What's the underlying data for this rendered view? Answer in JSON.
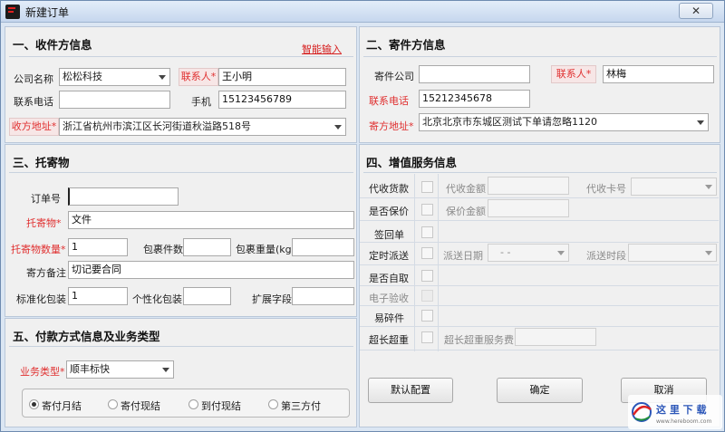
{
  "window": {
    "title": "新建订单",
    "close_label": "✕"
  },
  "recipient": {
    "section_title": "一、收件方信息",
    "smart_input_link": "智能输入",
    "company_label": "公司名称",
    "company_value": "松松科技",
    "contact_label": "联系人*",
    "contact_value": "王小明",
    "phone_label": "联系电话",
    "phone_value": "",
    "mobile_label": "手机",
    "mobile_value": "15123456789",
    "address_label": "收方地址*",
    "address_value": "浙江省杭州市滨江区长河街道秋溢路518号"
  },
  "sender": {
    "section_title": "二、寄件方信息",
    "company_label": "寄件公司",
    "company_value": "",
    "contact_label": "联系人*",
    "contact_value": "林梅",
    "phone_label": "联系电话",
    "phone_value": "15212345678",
    "address_label": "寄方地址*",
    "address_value": "北京北京市东城区测试下单请忽略1120"
  },
  "consignment": {
    "section_title": "三、托寄物",
    "order_no_label": "订单号",
    "order_no_value": "",
    "item_label": "托寄物*",
    "item_value": "文件",
    "qty_label": "托寄物数量*",
    "qty_value": "1",
    "pkg_count_label": "包裹件数",
    "pkg_count_value": "",
    "pkg_weight_label": "包裹重量(kg)",
    "pkg_weight_value": "",
    "remark_label": "寄方备注",
    "remark_value": "切记要合同",
    "std_pkg_label": "标准化包装",
    "std_pkg_value": "1",
    "custom_pkg_label": "个性化包装",
    "custom_pkg_value": "",
    "ext_label": "扩展字段",
    "ext_value": ""
  },
  "services": {
    "section_title": "四、增值服务信息",
    "cod_label": "代收货款",
    "cod_amount_label": "代收金额",
    "cod_card_label": "代收卡号",
    "insure_label": "是否保价",
    "insure_amount_label": "保价金额",
    "sign_back_label": "签回单",
    "timed_label": "定时派送",
    "timed_date_label": "派送日期",
    "timed_date_value": "-  -",
    "timed_slot_label": "派送时段",
    "self_pickup_label": "是否自取",
    "e_check_label": "电子验收",
    "fragile_label": "易碎件",
    "oversize_label": "超长超重",
    "oversize_fee_label": "超长超重服务费"
  },
  "payment": {
    "section_title": "五、付款方式信息及业务类型",
    "biz_type_label": "业务类型*",
    "biz_type_value": "顺丰标快",
    "options": [
      "寄付月结",
      "寄付现结",
      "到付现结",
      "第三方付"
    ],
    "selected_index": 0
  },
  "actions": {
    "default_config": "默认配置",
    "confirm": "确定",
    "cancel": "取消"
  },
  "watermark": {
    "brand": "这里下载",
    "url": "www.hereboom.com"
  },
  "colors": {
    "required_red": "#e03030",
    "link_red": "#d62020",
    "panel_bg": "#f0f0f0",
    "frame_blue": "#dbe6f3"
  },
  "icons": {
    "app": "app-logo-icon",
    "close": "close-icon",
    "dropdown": "chevron-down-icon"
  }
}
